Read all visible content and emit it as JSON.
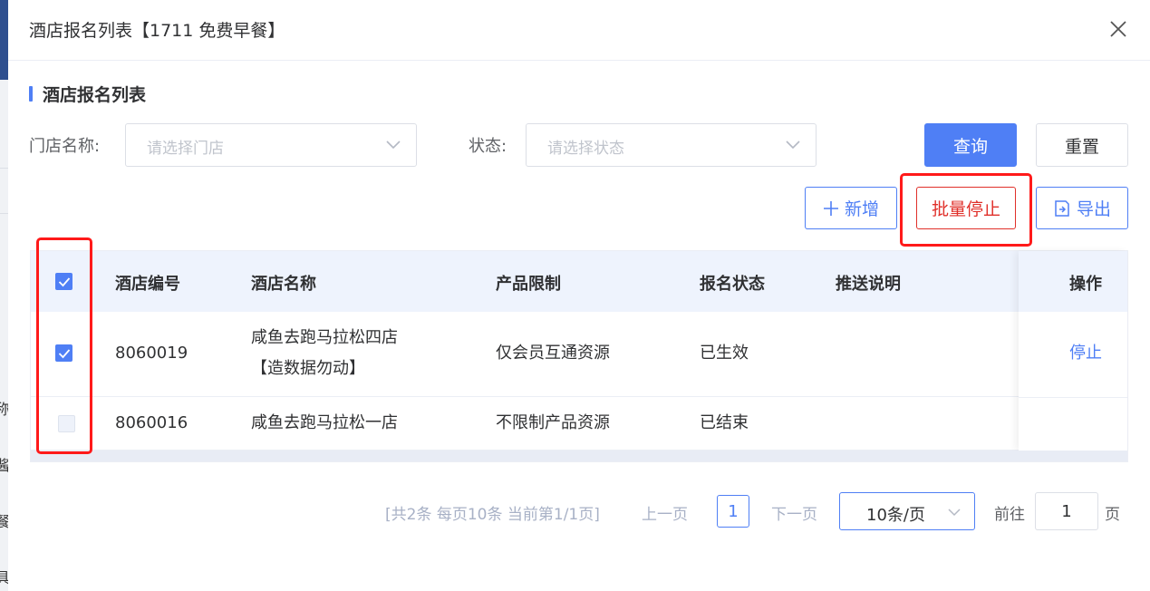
{
  "dialog": {
    "title": "酒店报名列表【1711 免费早餐】"
  },
  "section": {
    "title": "酒店报名列表"
  },
  "filters": {
    "store_label": "门店名称:",
    "store_placeholder": "请选择门店",
    "status_label": "状态:",
    "status_placeholder": "请选择状态",
    "query_button": "查询",
    "reset_button": "重置"
  },
  "toolbar": {
    "add_button": "新增",
    "batch_stop_button": "批量停止",
    "export_button": "导出"
  },
  "table": {
    "columns": {
      "code": "酒店编号",
      "name": "酒店名称",
      "product": "产品限制",
      "status": "报名状态",
      "note": "推送说明",
      "action": "操作"
    },
    "header_checked": true,
    "rows": [
      {
        "checked": true,
        "code": "8060019",
        "name_line1": "咸鱼去跑马拉松四店",
        "name_line2": "【造数据勿动】",
        "product": "仅会员互通资源",
        "status": "已生效",
        "note": "",
        "action": "停止"
      },
      {
        "checked": false,
        "code": "8060016",
        "name_line1": "咸鱼去跑马拉松一店",
        "name_line2": "",
        "product": "不限制产品资源",
        "status": "已结束",
        "note": "",
        "action": ""
      }
    ]
  },
  "pagination": {
    "summary": "[共2条 每页10条 当前第1/1页]",
    "prev": "上一页",
    "current_page": "1",
    "next": "下一页",
    "page_size": "10条/页",
    "goto_label": "前往",
    "goto_value": "1",
    "page_suffix": "页"
  },
  "background": {
    "partial_chars": [
      "称",
      "酱",
      "餐",
      "具"
    ]
  },
  "colors": {
    "primary": "#4f7ff5",
    "danger": "#e0302a",
    "highlight": "#ff1a1a",
    "header_bg": "#eef3fd"
  }
}
